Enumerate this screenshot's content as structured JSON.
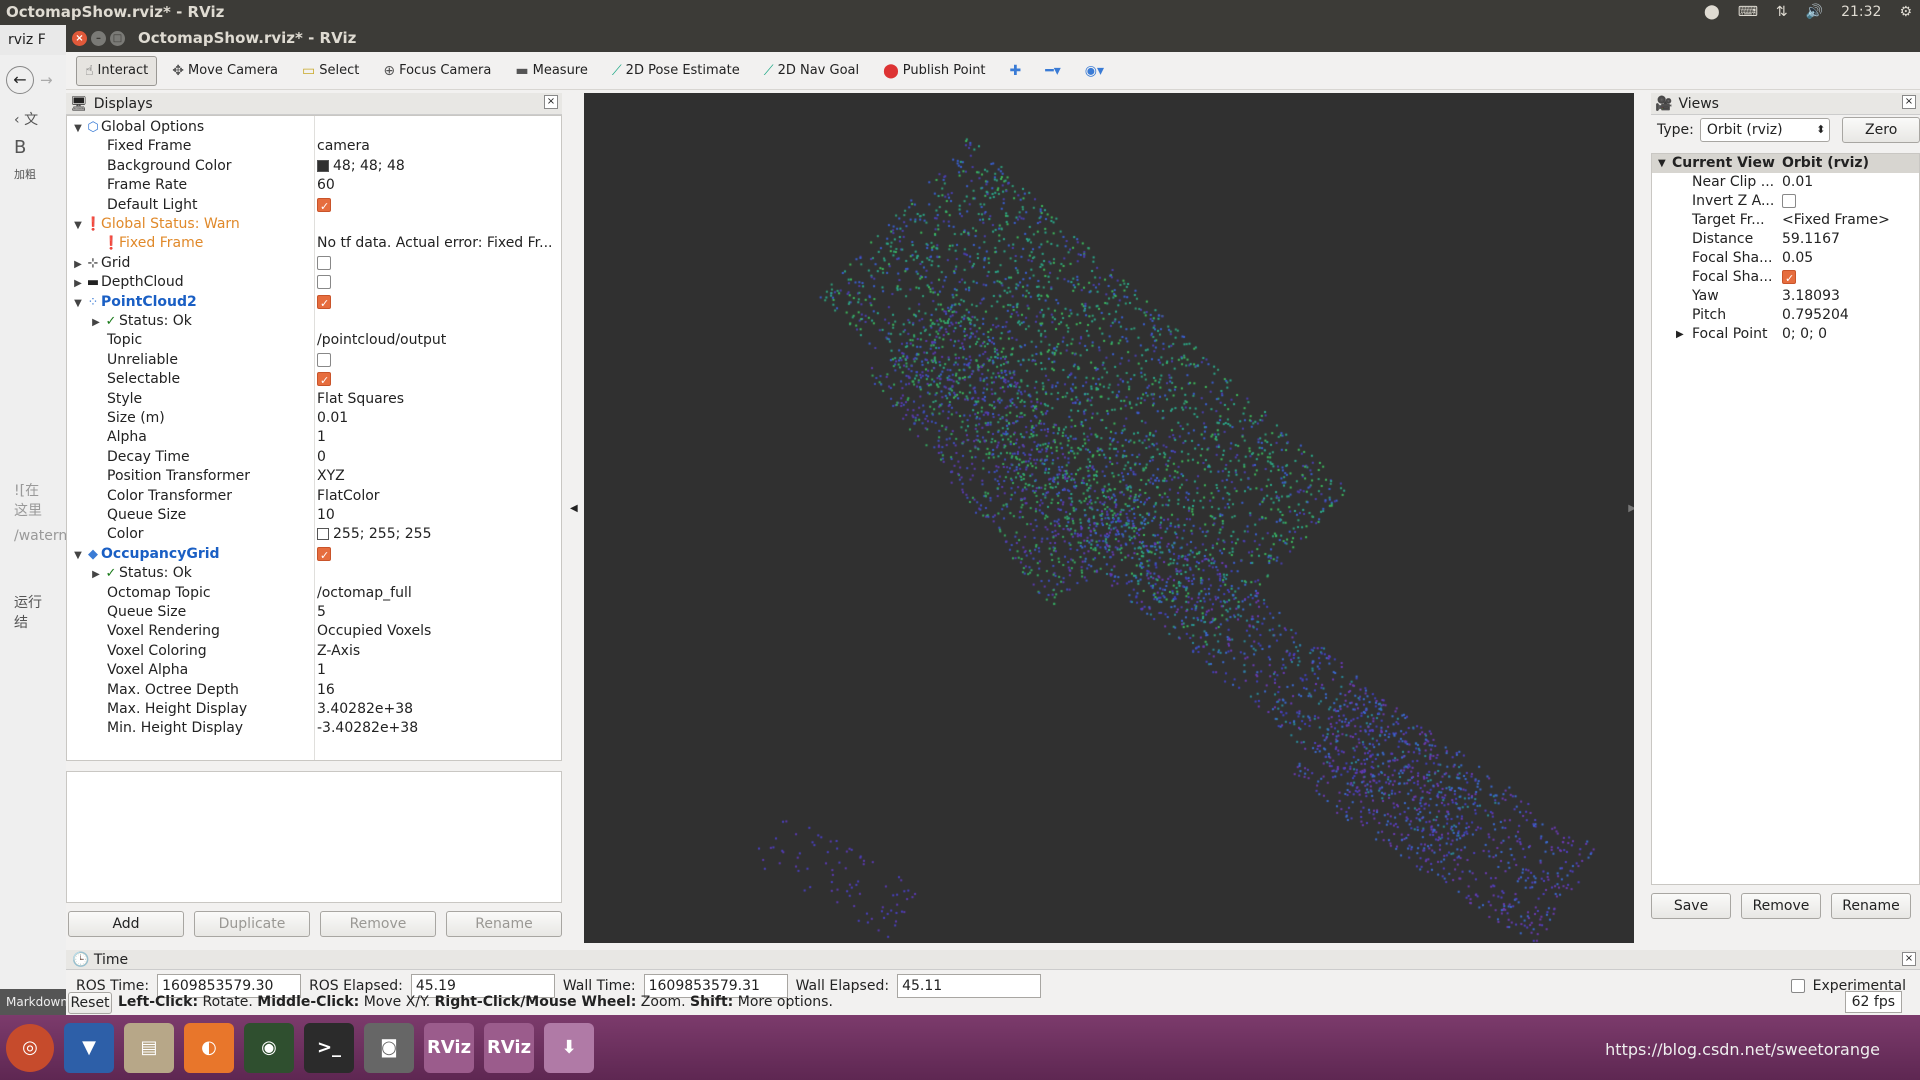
{
  "os_topbar": {
    "title": "OctomapShow.rviz* - RViz",
    "clock": "21:32"
  },
  "bg_app": {
    "tab": "rviz F",
    "menu_text": "文",
    "bold_label": "B",
    "bold_caption": "加粗",
    "text1": "![在这里",
    "text2": "/watern",
    "text3": "运行结",
    "markdown": "Markdown"
  },
  "window": {
    "title": "OctomapShow.rviz* - RViz"
  },
  "toolbar": {
    "interact": "Interact",
    "move_camera": "Move Camera",
    "select": "Select",
    "focus_camera": "Focus Camera",
    "measure": "Measure",
    "pose_estimate": "2D Pose Estimate",
    "nav_goal": "2D Nav Goal",
    "publish_point": "Publish Point"
  },
  "displays": {
    "title": "Displays",
    "rows": [
      {
        "indent": 0,
        "arrow": "▼",
        "icon": "globe",
        "key": "Global Options",
        "value": "",
        "style": ""
      },
      {
        "indent": 1,
        "key": "Fixed Frame",
        "value": "camera"
      },
      {
        "indent": 1,
        "key": "Background Color",
        "value": "48; 48; 48",
        "swatch": "#303030"
      },
      {
        "indent": 1,
        "key": "Frame Rate",
        "value": "60"
      },
      {
        "indent": 1,
        "key": "Default Light",
        "check": true
      },
      {
        "indent": 0,
        "arrow": "▼",
        "icon": "warn",
        "key": "Global Status: Warn",
        "style": "warn"
      },
      {
        "indent": 1,
        "icon": "warn",
        "key": "Fixed Frame",
        "value": "No tf data.  Actual error: Fixed Fr...",
        "style": "warn"
      },
      {
        "indent": 0,
        "arrow": "▶",
        "icon": "grid",
        "key": "Grid",
        "check": false
      },
      {
        "indent": 0,
        "arrow": "▶",
        "icon": "depth",
        "key": "DepthCloud",
        "check": false
      },
      {
        "indent": 0,
        "arrow": "▼",
        "icon": "cloud",
        "key": "PointCloud2",
        "check": true,
        "style": "blue"
      },
      {
        "indent": 1,
        "arrow": "▶",
        "icon": "ok",
        "key": "Status: Ok"
      },
      {
        "indent": 1,
        "key": "Topic",
        "value": "/pointcloud/output"
      },
      {
        "indent": 1,
        "key": "Unreliable",
        "check": false
      },
      {
        "indent": 1,
        "key": "Selectable",
        "check": true
      },
      {
        "indent": 1,
        "key": "Style",
        "value": "Flat Squares"
      },
      {
        "indent": 1,
        "key": "Size (m)",
        "value": "0.01"
      },
      {
        "indent": 1,
        "key": "Alpha",
        "value": "1"
      },
      {
        "indent": 1,
        "key": "Decay Time",
        "value": "0"
      },
      {
        "indent": 1,
        "key": "Position Transformer",
        "value": "XYZ"
      },
      {
        "indent": 1,
        "key": "Color Transformer",
        "value": "FlatColor"
      },
      {
        "indent": 1,
        "key": "Queue Size",
        "value": "10"
      },
      {
        "indent": 1,
        "key": "Color",
        "value": "255; 255; 255",
        "swatch": "#ffffff"
      },
      {
        "indent": 0,
        "arrow": "▼",
        "icon": "grid2",
        "key": "OccupancyGrid",
        "check": true,
        "style": "blue"
      },
      {
        "indent": 1,
        "arrow": "▶",
        "icon": "ok",
        "key": "Status: Ok"
      },
      {
        "indent": 1,
        "key": "Octomap Topic",
        "value": "/octomap_full"
      },
      {
        "indent": 1,
        "key": "Queue Size",
        "value": "5"
      },
      {
        "indent": 1,
        "key": "Voxel Rendering",
        "value": "Occupied Voxels"
      },
      {
        "indent": 1,
        "key": "Voxel Coloring",
        "value": "Z-Axis"
      },
      {
        "indent": 1,
        "key": "Voxel Alpha",
        "value": "1"
      },
      {
        "indent": 1,
        "key": "Max. Octree Depth",
        "value": "16"
      },
      {
        "indent": 1,
        "key": "Max. Height Display",
        "value": "3.40282e+38"
      },
      {
        "indent": 1,
        "key": "Min. Height Display",
        "value": "-3.40282e+38"
      }
    ],
    "buttons": {
      "add": "Add",
      "duplicate": "Duplicate",
      "remove": "Remove",
      "rename": "Rename"
    }
  },
  "views": {
    "title": "Views",
    "type_label": "Type:",
    "type_value": "Orbit (rviz)",
    "zero": "Zero",
    "header_key": "Current View",
    "header_value": "Orbit (rviz)",
    "rows": [
      {
        "key": "Near Clip ...",
        "value": "0.01"
      },
      {
        "key": "Invert Z A...",
        "check": false
      },
      {
        "key": "Target Fr...",
        "value": "<Fixed Frame>"
      },
      {
        "key": "Distance",
        "value": "59.1167"
      },
      {
        "key": "Focal Sha...",
        "value": "0.05"
      },
      {
        "key": "Focal Sha...",
        "check": true
      },
      {
        "key": "Yaw",
        "value": "3.18093"
      },
      {
        "key": "Pitch",
        "value": "0.795204"
      },
      {
        "key": "Focal Point",
        "value": "0; 0; 0",
        "arrow": "▶"
      }
    ],
    "buttons": {
      "save": "Save",
      "remove": "Remove",
      "rename": "Rename"
    }
  },
  "time": {
    "title": "Time",
    "ros_time_label": "ROS Time:",
    "ros_time": "1609853579.30",
    "ros_elapsed_label": "ROS Elapsed:",
    "ros_elapsed": "45.19",
    "wall_time_label": "Wall Time:",
    "wall_time": "1609853579.31",
    "wall_elapsed_label": "Wall Elapsed:",
    "wall_elapsed": "45.11",
    "experimental": "Experimental"
  },
  "status": {
    "reset": "Reset",
    "lc": "Left-Click:",
    "lc_t": "Rotate.",
    "mc": "Middle-Click:",
    "mc_t": "Move X/Y.",
    "rc": "Right-Click/Mouse Wheel:",
    "rc_t": "Zoom.",
    "sh": "Shift:",
    "sh_t": "More options.",
    "fps": "62 fps"
  },
  "launcher": {
    "icons": [
      "ubuntu",
      "transmission",
      "files",
      "firefox",
      "aperture",
      "terminal",
      "camera",
      "rviz",
      "rviz",
      "installer"
    ],
    "rviz": "RViz"
  },
  "watermark": "https://blog.csdn.net/sweetorange"
}
